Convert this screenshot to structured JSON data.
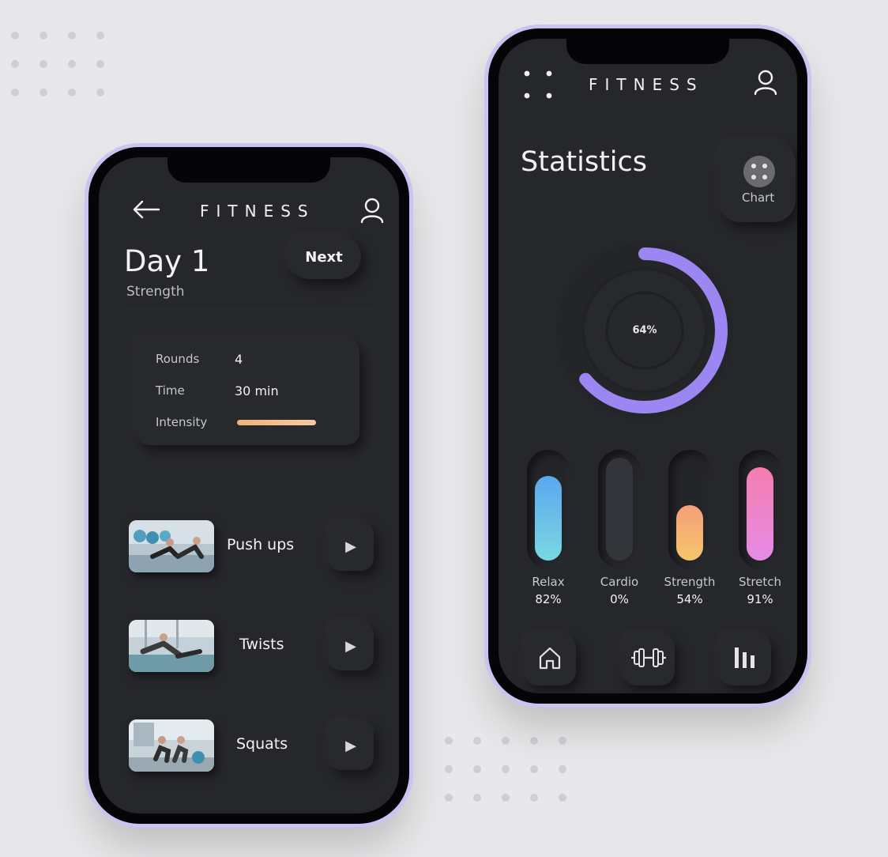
{
  "left_screen": {
    "brand": "FITNESS",
    "day_title": "Day 1",
    "day_subtitle": "Strength",
    "next_label": "Next",
    "info": {
      "rounds_label": "Rounds",
      "rounds_value": "4",
      "time_label": "Time",
      "time_value": "30 min",
      "intensity_label": "Intensity"
    },
    "exercises": [
      {
        "label": "Push ups",
        "icon": "play-icon"
      },
      {
        "label": "Twists",
        "icon": "play-icon"
      },
      {
        "label": "Squats",
        "icon": "play-icon"
      }
    ]
  },
  "right_screen": {
    "brand": "FITNESS",
    "title": "Statistics",
    "chart_label": "Chart",
    "ring": {
      "value": "64%",
      "color": "#9b86f2"
    },
    "bars": [
      {
        "name": "Relax",
        "value": "82%",
        "level": 0.82,
        "color_from": "#5aa7ef",
        "color_to": "#7ad8e2"
      },
      {
        "name": "Cardio",
        "value": "0%",
        "level": 0,
        "color_from": "#34353a",
        "color_to": "#34353a"
      },
      {
        "name": "Strength",
        "value": "54%",
        "level": 0.54,
        "color_from": "#f5a07a",
        "color_to": "#f6c56a"
      },
      {
        "name": "Stretch",
        "value": "91%",
        "level": 0.91,
        "color_from": "#f47eb0",
        "color_to": "#e68be6"
      }
    ],
    "nav": [
      "home-icon",
      "dumbbell-icon",
      "bar-chart-icon"
    ]
  },
  "colors": {
    "background": "#e8e8ea",
    "screen": "#26272b",
    "accent": "#9b86f2",
    "intensity": "#f0b27a"
  }
}
